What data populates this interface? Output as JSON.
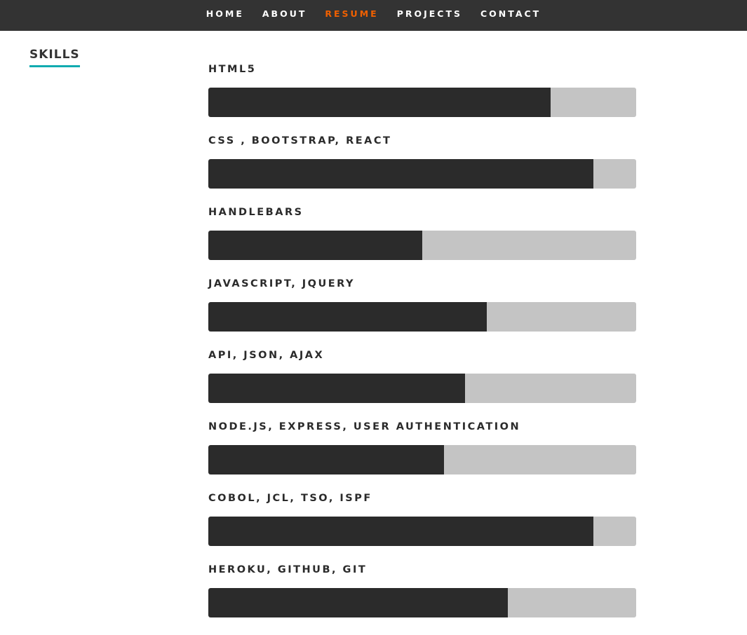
{
  "nav": {
    "items": [
      {
        "label": "HOME",
        "active": false
      },
      {
        "label": "ABOUT",
        "active": false
      },
      {
        "label": "RESUME",
        "active": true
      },
      {
        "label": "PROJECTS",
        "active": false
      },
      {
        "label": "CONTACT",
        "active": false
      }
    ],
    "active_color": "#f06000",
    "background": "#333333"
  },
  "section": {
    "title": "SKILLS",
    "underline_color": "#11abb0"
  },
  "skills": [
    {
      "label": "HTML5",
      "level_percent": 80
    },
    {
      "label": "CSS , BOOTSTRAP, REACT",
      "level_percent": 90
    },
    {
      "label": "HANDLEBARS",
      "level_percent": 50
    },
    {
      "label": "JAVASCRIPT, JQUERY",
      "level_percent": 65
    },
    {
      "label": "API, JSON, AJAX",
      "level_percent": 60
    },
    {
      "label": "NODE.JS, EXPRESS, USER AUTHENTICATION",
      "level_percent": 55
    },
    {
      "label": "COBOL, JCL, TSO, ISPF",
      "level_percent": 90
    },
    {
      "label": "HEROKU, GITHUB, GIT",
      "level_percent": 70
    }
  ]
}
